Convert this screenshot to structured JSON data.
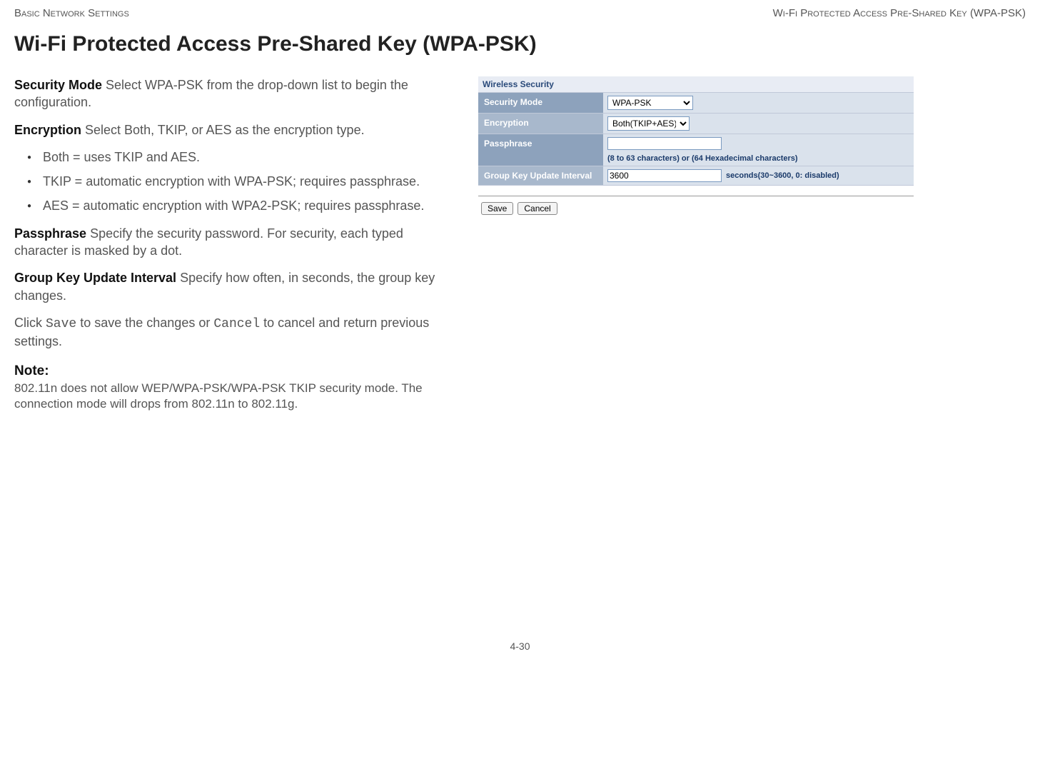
{
  "header": {
    "left": "Basic Network Settings",
    "right": "Wi-Fi Protected Access Pre-Shared Key (WPA-PSK)"
  },
  "title": "Wi-Fi Protected Access Pre-Shared Key (WPA-PSK)",
  "body": {
    "security_mode_label": "Security Mode",
    "security_mode_text": "  Select WPA-PSK from the drop-down list to begin the configuration.",
    "encryption_label": "Encryption",
    "encryption_text": "  Select Both, TKIP, or AES as the encryption type.",
    "bullets": [
      "Both = uses TKIP and AES.",
      "TKIP = automatic encryption with WPA-PSK; requires passphrase.",
      "AES = automatic encryption with WPA2-PSK; requires passphrase."
    ],
    "passphrase_label": "Passphrase",
    "passphrase_text": "  Specify the security password. For security, each typed character is masked by a dot.",
    "gkui_label": "Group Key Update Interval",
    "gkui_text": "  Specify how often, in seconds, the group key changes.",
    "click_prefix": "Click ",
    "save_word": "Save",
    "click_mid": " to save the changes or ",
    "cancel_word": "Cancel",
    "click_suffix": " to cancel and return previous settings.",
    "note_label": "Note:",
    "note_text": "802.11n does not allow WEP/WPA-PSK/WPA-PSK TKIP security mode. The connection mode will drops from 802.11n to 802.11g."
  },
  "panel": {
    "section_title": "Wireless Security",
    "rows": {
      "security_mode": {
        "label": "Security Mode",
        "value": "WPA-PSK"
      },
      "encryption": {
        "label": "Encryption",
        "value": "Both(TKIP+AES)"
      },
      "passphrase": {
        "label": "Passphrase",
        "value": "",
        "hint": "(8 to 63 characters) or (64 Hexadecimal characters)"
      },
      "interval": {
        "label": "Group Key Update Interval",
        "value": "3600",
        "hint": "seconds(30~3600, 0: disabled)"
      }
    },
    "buttons": {
      "save": "Save",
      "cancel": "Cancel"
    }
  },
  "footer": {
    "page": "4-30"
  }
}
